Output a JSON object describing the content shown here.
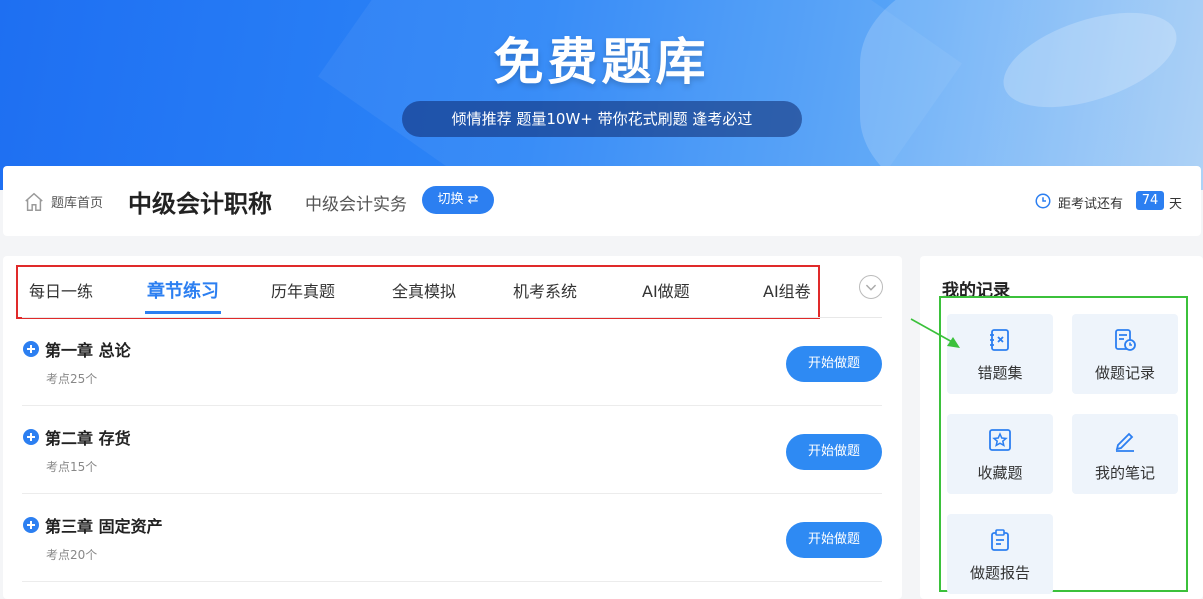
{
  "banner": {
    "title": "免费题库",
    "subtitle": "倾情推荐 题量10W+ 带你花式刷题 逢考必过"
  },
  "header": {
    "breadcrumb_home": "题库首页",
    "cert_title": "中级会计职称",
    "subject": "中级会计实务",
    "switch_label": "切换 ⇄",
    "countdown_label": "距考试还有",
    "countdown_days": "74",
    "countdown_unit": "天"
  },
  "tabs": [
    {
      "label": "每日一练",
      "active": false
    },
    {
      "label": "章节练习",
      "active": true
    },
    {
      "label": "历年真题",
      "active": false
    },
    {
      "label": "全真模拟",
      "active": false
    },
    {
      "label": "机考系统",
      "active": false
    },
    {
      "label": "AI做题",
      "active": false
    },
    {
      "label": "AI组卷",
      "active": false
    }
  ],
  "chapters": [
    {
      "title": "第一章 总论",
      "points": "考点25个",
      "button": "开始做题"
    },
    {
      "title": "第二章 存货",
      "points": "考点15个",
      "button": "开始做题"
    },
    {
      "title": "第三章 固定资产",
      "points": "考点20个",
      "button": "开始做题"
    }
  ],
  "records": {
    "title": "我的记录",
    "items": [
      {
        "label": "错题集",
        "icon": "wrong-notebook-icon"
      },
      {
        "label": "做题记录",
        "icon": "history-icon"
      },
      {
        "label": "收藏题",
        "icon": "star-icon"
      },
      {
        "label": "我的笔记",
        "icon": "pencil-icon"
      },
      {
        "label": "做题报告",
        "icon": "report-icon"
      }
    ]
  },
  "colors": {
    "accent": "#2c7ff1",
    "red_highlight": "#e02a2a",
    "green_highlight": "#3bc13b"
  }
}
